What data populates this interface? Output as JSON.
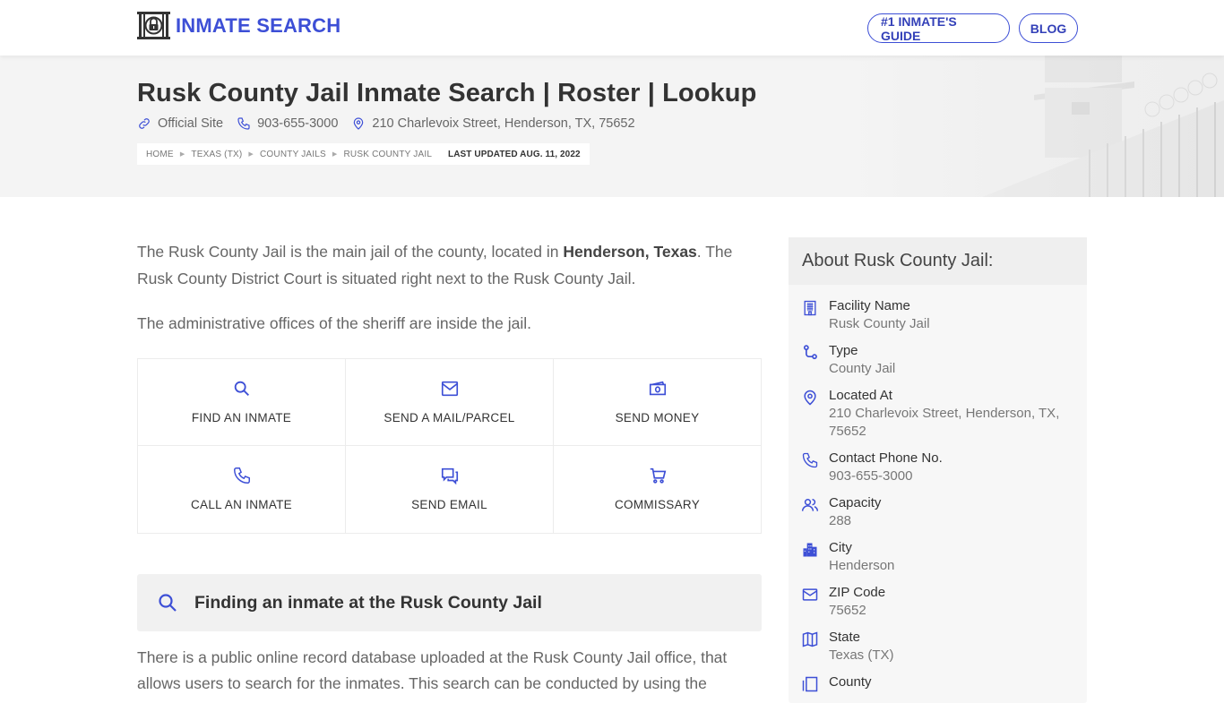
{
  "header": {
    "logo_text": "INMATE SEARCH",
    "nav": [
      {
        "label": "#1 INMATE'S GUIDE"
      },
      {
        "label": "BLOG"
      }
    ]
  },
  "hero": {
    "title": "Rusk County Jail Inmate Search | Roster | Lookup",
    "meta": {
      "official_site": "Official Site",
      "phone": "903-655-3000",
      "address": "210 Charlevoix Street, Henderson, TX, 75652"
    },
    "breadcrumb": [
      "HOME",
      "TEXAS (TX)",
      "COUNTY JAILS",
      "RUSK COUNTY JAIL"
    ],
    "last_updated": "LAST UPDATED AUG. 11, 2022"
  },
  "intro": {
    "p1_start": "The Rusk County Jail is the main jail of the county, located in ",
    "p1_bold": "Henderson, Texas",
    "p1_end": ". The Rusk County District Court is situated right next to the Rusk County Jail.",
    "p2": "The administrative offices of the sheriff are inside the jail."
  },
  "actions": [
    {
      "label": "FIND AN INMATE",
      "icon": "search-icon"
    },
    {
      "label": "SEND A MAIL/PARCEL",
      "icon": "mail-icon"
    },
    {
      "label": "SEND MONEY",
      "icon": "money-icon"
    },
    {
      "label": "CALL AN INMATE",
      "icon": "phone-icon"
    },
    {
      "label": "SEND EMAIL",
      "icon": "chat-icon"
    },
    {
      "label": "COMMISSARY",
      "icon": "cart-icon"
    }
  ],
  "finding": {
    "title": "Finding an inmate at the Rusk County Jail",
    "text": "There is a public online record database uploaded at the Rusk County Jail office, that allows users to search for the inmates. This search can be conducted by using the"
  },
  "about": {
    "title": "About Rusk County Jail:",
    "items": [
      {
        "label": "Facility Name",
        "value": "Rusk County Jail",
        "icon": "building-icon"
      },
      {
        "label": "Type",
        "value": "County Jail",
        "icon": "route-icon"
      },
      {
        "label": "Located At",
        "value": "210 Charlevoix Street, Henderson, TX, 75652",
        "icon": "location-pin-icon"
      },
      {
        "label": "Contact Phone No.",
        "value": "903-655-3000",
        "icon": "phone-icon"
      },
      {
        "label": "Capacity",
        "value": "288",
        "icon": "users-icon"
      },
      {
        "label": "City",
        "value": "Henderson",
        "icon": "city-icon"
      },
      {
        "label": "ZIP Code",
        "value": "75652",
        "icon": "mail-icon"
      },
      {
        "label": "State",
        "value": "Texas (TX)",
        "icon": "map-icon"
      },
      {
        "label": "County",
        "value": "",
        "icon": "county-icon"
      }
    ]
  },
  "colors": {
    "accent": "#3d4fd6",
    "hero_bg": "#f4f4f4",
    "text": "#666666"
  }
}
